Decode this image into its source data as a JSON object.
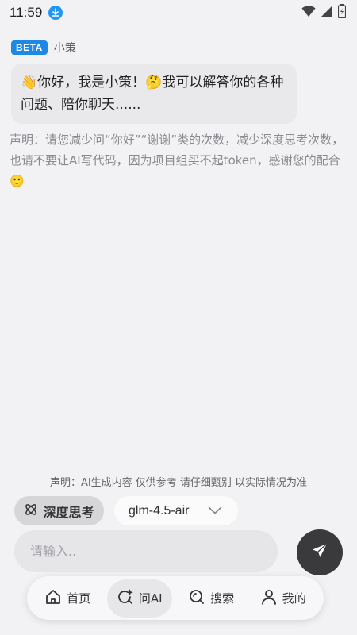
{
  "status_bar": {
    "time": "11:59",
    "icons": [
      "download-icon",
      "wifi-icon",
      "signal-icon",
      "battery-icon"
    ]
  },
  "chat": {
    "badge": "BETA",
    "bot_name": "小策",
    "greeting": "👋你好，我是小策！🤔我可以解答你的各种问题、陪你聊天......",
    "disclaimer": "声明：请您减少问“你好”“谢谢”类的次数，减少深度思考次数，也请不要让AI写代码，因为项目组买不起token，感谢您的配合🙂"
  },
  "composer": {
    "notice": "声明：AI生成内容 仅供参考 请仔细甄别 以实际情况为准",
    "deep_think_label": "深度思考",
    "model_selected": "glm-4.5-air",
    "input_placeholder": "请输入.."
  },
  "nav": {
    "items": [
      {
        "label": "首页",
        "icon": "home-icon"
      },
      {
        "label": "问AI",
        "icon": "ask-ai-icon"
      },
      {
        "label": "搜索",
        "icon": "search-icon"
      },
      {
        "label": "我的",
        "icon": "profile-icon"
      }
    ],
    "active_index": 1
  },
  "colors": {
    "accent": "#1e88e5",
    "send_button": "#3a3a3c",
    "background": "#f2f2f4"
  }
}
